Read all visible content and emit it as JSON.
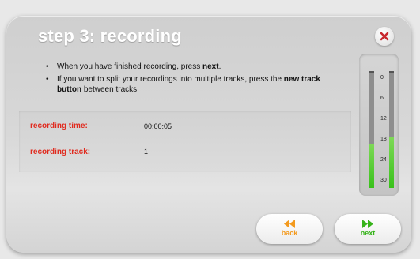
{
  "dialog": {
    "title": "step 3: recording",
    "close_icon": "close-x-icon",
    "instructions": {
      "item1_pre": "When you have finished recording, press ",
      "item1_bold": "next",
      "item1_post": ".",
      "item2_pre": "If you want to split your recordings into multiple tracks, press the ",
      "item2_bold": "new track button",
      "item2_post": " between tracks."
    },
    "info": {
      "time_label": "recording time:",
      "time_value": "00:00:05",
      "track_label": "recording track:",
      "track_value": "1"
    },
    "meter": {
      "scale": [
        "0",
        "6",
        "12",
        "18",
        "24",
        "30"
      ],
      "left_level": 0.38,
      "right_level": 0.43
    },
    "buttons": {
      "back_label": "back",
      "next_label": "next"
    }
  },
  "colors": {
    "accent_red": "#e02a1e",
    "back_orange": "#f39a1e",
    "next_green": "#36b31a",
    "meter_green": "#38c11a"
  }
}
